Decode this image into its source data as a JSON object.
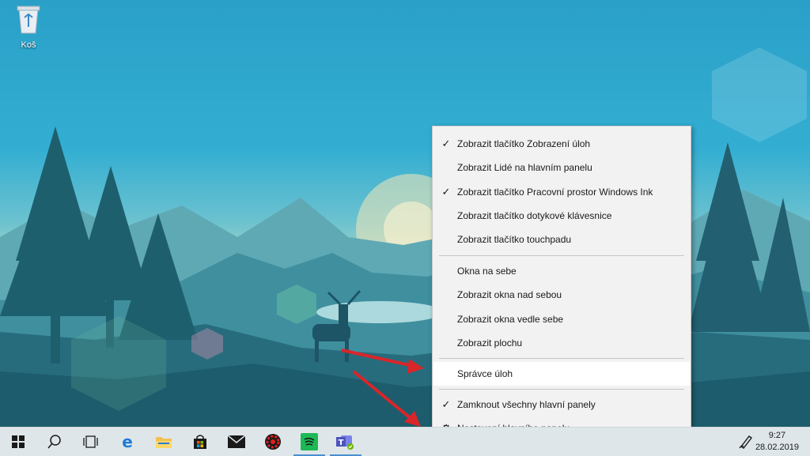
{
  "desktop": {
    "recycle_bin_label": "Koš"
  },
  "context_menu": {
    "items": [
      {
        "label": "Zobrazit tlačítko Zobrazení úloh",
        "checked": true
      },
      {
        "label": "Zobrazit Lidé na hlavním panelu",
        "checked": false
      },
      {
        "label": "Zobrazit tlačítko Pracovní prostor Windows Ink",
        "checked": true
      },
      {
        "label": "Zobrazit tlačítko dotykové klávesnice",
        "checked": false
      },
      {
        "label": "Zobrazit tlačítko touchpadu",
        "checked": false
      },
      {
        "label": "Okna na sebe",
        "checked": false
      },
      {
        "label": "Zobrazit okna nad sebou",
        "checked": false
      },
      {
        "label": "Zobrazit okna vedle sebe",
        "checked": false
      },
      {
        "label": "Zobrazit plochu",
        "checked": false
      },
      {
        "label": "Správce úloh",
        "checked": false,
        "highlighted": true
      },
      {
        "label": "Zamknout všechny hlavní panely",
        "checked": true
      },
      {
        "label": "Nastavení hlavního panelu",
        "checked": false,
        "icon": "gear-icon"
      }
    ],
    "check_glyph": "✓",
    "gear_glyph": "⚙"
  },
  "taskbar": {
    "buttons": [
      {
        "name": "start-button",
        "icon": "windows-logo-icon"
      },
      {
        "name": "search-button",
        "icon": "search-icon"
      },
      {
        "name": "task-view-button",
        "icon": "task-view-icon"
      },
      {
        "name": "edge-button",
        "icon": "edge-icon"
      },
      {
        "name": "file-explorer-button",
        "icon": "folder-icon"
      },
      {
        "name": "store-button",
        "icon": "store-bag-icon"
      },
      {
        "name": "mail-button",
        "icon": "mail-icon"
      },
      {
        "name": "app-red-button",
        "icon": "red-gear-app-icon"
      },
      {
        "name": "spotify-button",
        "icon": "spotify-icon",
        "active": true
      },
      {
        "name": "teams-button",
        "icon": "teams-icon",
        "active": true
      }
    ],
    "clock_time": "9:27",
    "clock_date": "28.02.2019"
  },
  "colors": {
    "accent": "#4a8fcf",
    "menu_bg": "#f2f2f2",
    "taskbar_bg": "#dfe6ea"
  }
}
